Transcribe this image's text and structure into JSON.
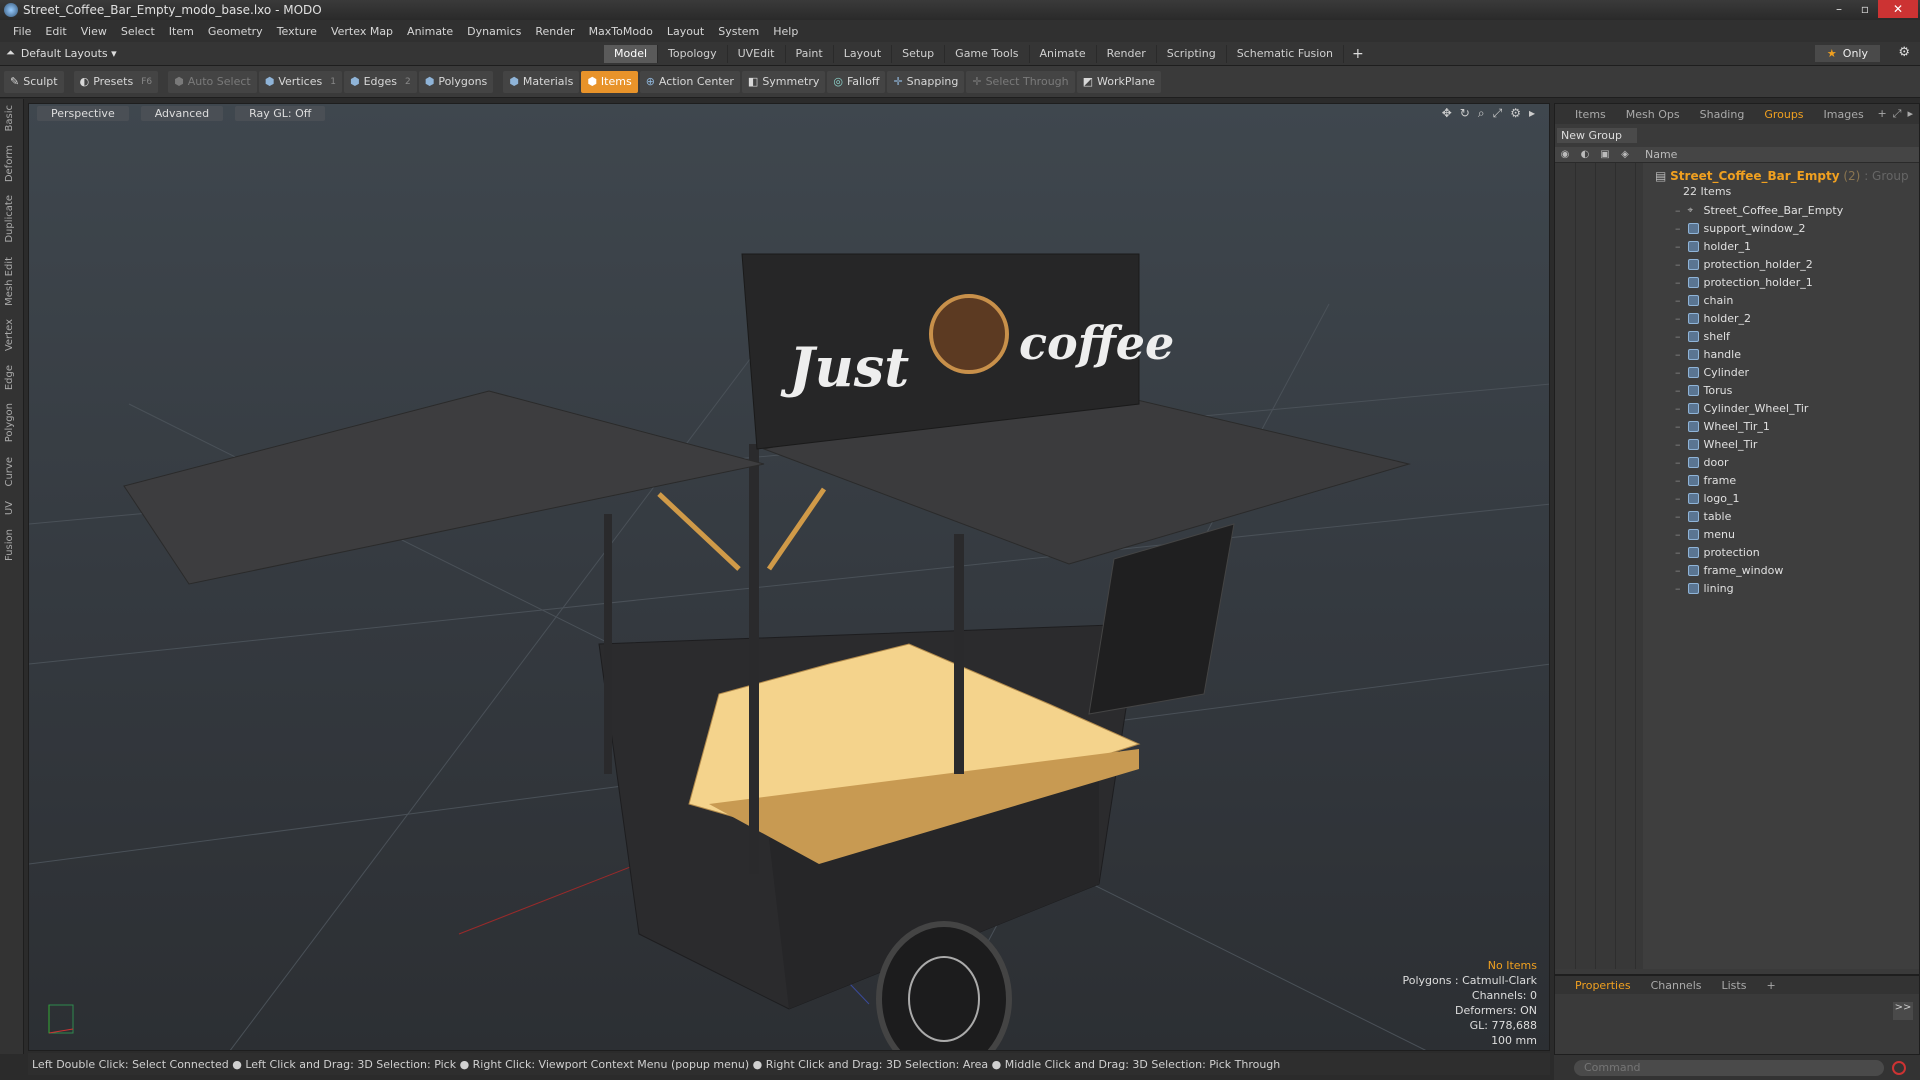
{
  "window": {
    "title": "Street_Coffee_Bar_Empty_modo_base.lxo - MODO",
    "controls": [
      "–",
      "▫",
      "✕"
    ]
  },
  "menubar": [
    "File",
    "Edit",
    "View",
    "Select",
    "Item",
    "Geometry",
    "Texture",
    "Vertex Map",
    "Animate",
    "Dynamics",
    "Render",
    "MaxToModo",
    "Layout",
    "System",
    "Help"
  ],
  "layoutbar": {
    "layout_dropdown": "Default Layouts ▾",
    "tabs": [
      "Model",
      "Topology",
      "UVEdit",
      "Paint",
      "Layout",
      "Setup",
      "Game Tools",
      "Animate",
      "Render",
      "Scripting",
      "Schematic Fusion"
    ],
    "active_tab": "Model",
    "add": "+",
    "only_label": "Only"
  },
  "toolbar": {
    "sculpt": "Sculpt",
    "presets": "Presets",
    "presets_key": "F6",
    "auto_select": "Auto Select",
    "vertices": "Vertices",
    "vertices_key": "1",
    "edges": "Edges",
    "edges_key": "2",
    "polygons": "Polygons",
    "materials": "Materials",
    "items": "Items",
    "action_center": "Action Center",
    "symmetry": "Symmetry",
    "falloff": "Falloff",
    "snapping": "Snapping",
    "select_through": "Select Through",
    "workplane": "WorkPlane"
  },
  "left_tabs": [
    "Basic",
    "Deform",
    "Duplicate",
    "Mesh Edit",
    "Vertex",
    "Edge",
    "Polygon",
    "Curve",
    "UV",
    "Fusion"
  ],
  "viewport": {
    "view_mode": "Perspective",
    "shading": "Advanced",
    "raygl": "Ray GL: Off",
    "scene_sign_text": [
      "Just",
      "coffee"
    ],
    "info": {
      "no_items": "No Items",
      "polygons": "Polygons : Catmull-Clark",
      "channels": "Channels: 0",
      "deformers": "Deformers: ON",
      "gl": "GL: 778,688",
      "scale": "100 mm"
    }
  },
  "statusbar": {
    "text": "Left Double Click: Select Connected ● Left Click and Drag: 3D Selection: Pick ● Right Click: Viewport Context Menu (popup menu) ● Right Click and Drag: 3D Selection: Area ● Middle Click and Drag: 3D Selection: Pick Through"
  },
  "right_panel": {
    "tabs": [
      "Items",
      "Mesh Ops",
      "Shading",
      "Groups",
      "Images"
    ],
    "active_tab": "Groups",
    "new_group": "New Group",
    "name_header": "Name",
    "group": {
      "name": "Street_Coffee_Bar_Empty",
      "count": "(2)",
      "type": ": Group",
      "items_count": "22 Items"
    },
    "items": [
      "Street_Coffee_Bar_Empty",
      "support_window_2",
      "holder_1",
      "protection_holder_2",
      "protection_holder_1",
      "chain",
      "holder_2",
      "shelf",
      "handle",
      "Cylinder",
      "Torus",
      "Cylinder_Wheel_Tir",
      "Wheel_Tir_1",
      "Wheel_Tir",
      "door",
      "frame",
      "logo_1",
      "table",
      "menu",
      "protection",
      "frame_window",
      "lining"
    ]
  },
  "properties_panel": {
    "tabs": [
      "Properties",
      "Channels",
      "Lists"
    ],
    "active_tab": "Properties",
    "add": "+",
    "expand": ">>"
  },
  "command": {
    "placeholder": "Command"
  },
  "colors": {
    "accent": "#e8932a",
    "group_name": "#f0a020",
    "close": "#cc3333"
  }
}
